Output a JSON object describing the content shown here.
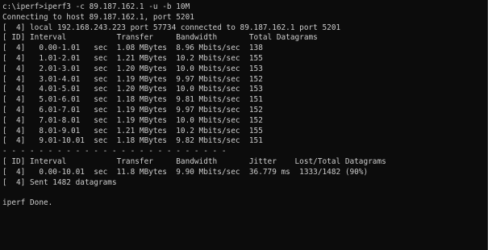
{
  "terminal": {
    "lines": [
      "c:\\iperf>iperf3 -c 89.187.162.1 -u -b 10M",
      "Connecting to host 89.187.162.1, port 5201",
      "[  4] local 192.168.243.223 port 57734 connected to 89.187.162.1 port 5201",
      "[ ID] Interval           Transfer     Bandwidth       Total Datagrams",
      "[  4]   0.00-1.01   sec  1.08 MBytes  8.96 Mbits/sec  138",
      "[  4]   1.01-2.01   sec  1.21 MBytes  10.2 Mbits/sec  155",
      "[  4]   2.01-3.01   sec  1.20 MBytes  10.0 Mbits/sec  153",
      "[  4]   3.01-4.01   sec  1.19 MBytes  9.97 Mbits/sec  152",
      "[  4]   4.01-5.01   sec  1.20 MBytes  10.0 Mbits/sec  153",
      "[  4]   5.01-6.01   sec  1.18 MBytes  9.81 Mbits/sec  151",
      "[  4]   6.01-7.01   sec  1.19 MBytes  9.97 Mbits/sec  152",
      "[  4]   7.01-8.01   sec  1.19 MBytes  10.0 Mbits/sec  152",
      "[  4]   8.01-9.01   sec  1.21 MBytes  10.2 Mbits/sec  155",
      "[  4]   9.01-10.01  sec  1.18 MBytes  9.82 Mbits/sec  151",
      "- - - - - - - - - - - - - - - - - - - - - - - - -",
      "[ ID] Interval           Transfer     Bandwidth       Jitter    Lost/Total Datagrams",
      "[  4]   0.00-10.01  sec  11.8 MBytes  9.90 Mbits/sec  36.779 ms  1333/1482 (90%)",
      "[  4] Sent 1482 datagrams",
      "",
      "iperf Done.",
      ""
    ]
  },
  "colors": {
    "background": "#0c0c0c",
    "text": "#cccccc"
  }
}
